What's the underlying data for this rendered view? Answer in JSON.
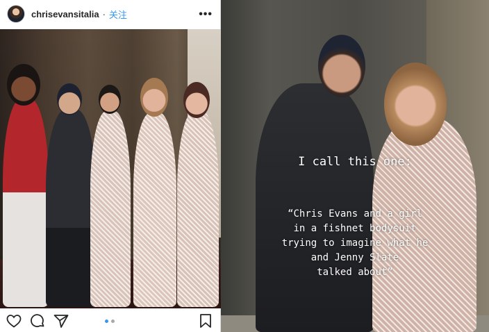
{
  "post": {
    "username": "chrisevansitalia",
    "separator": "·",
    "follow_label": "关注",
    "more_icon": "more-options-icon",
    "actions": {
      "like_icon": "heart-icon",
      "comment_icon": "comment-icon",
      "share_icon": "share-icon",
      "save_icon": "bookmark-icon"
    },
    "carousel": {
      "count": 2,
      "active": 1
    }
  },
  "story": {
    "title": "I call this one:",
    "body": "“Chris Evans and a girl\nin a fishnet bodysuit\ntrying to imagine what he\nand Jenny Slate\ntalked about”"
  },
  "colors": {
    "accent": "#3897f0",
    "text": "#262626",
    "divider": "#dbdbdb"
  }
}
